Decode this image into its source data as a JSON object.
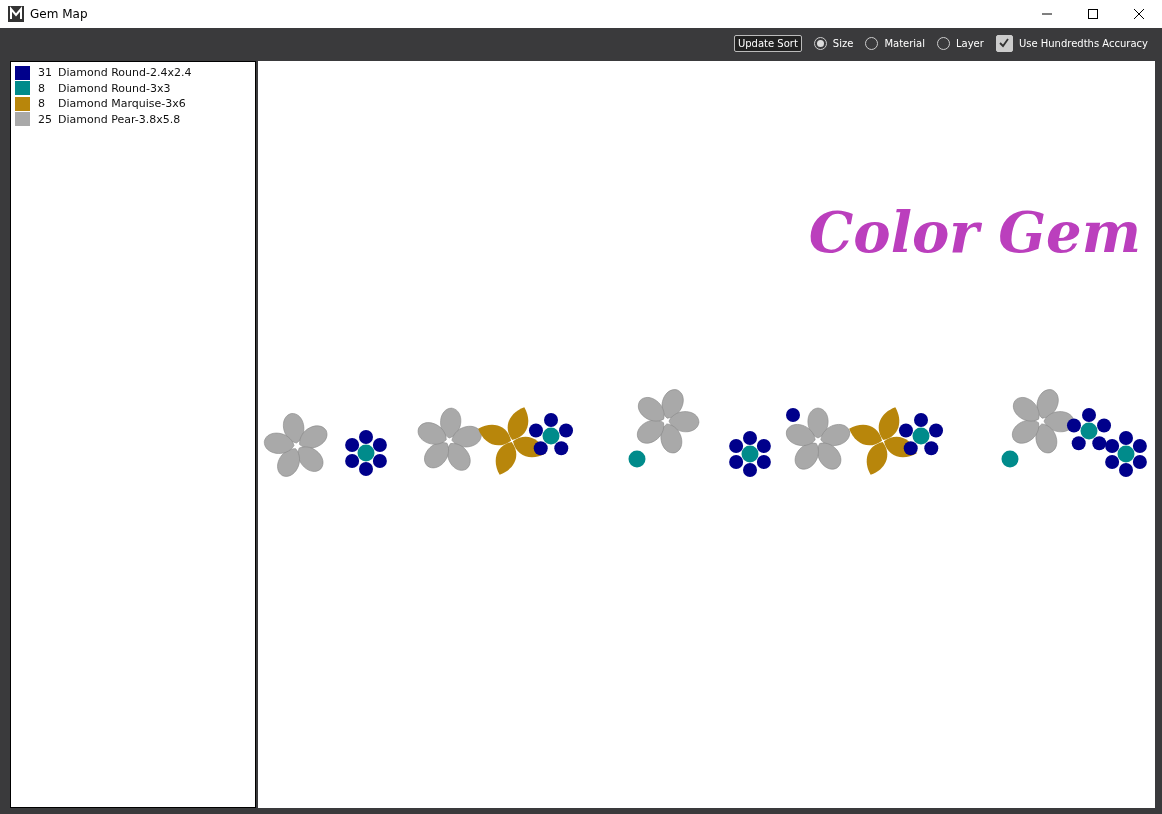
{
  "window": {
    "title": "Gem Map"
  },
  "toolbar": {
    "update_button": "Update Sort",
    "sort_options": [
      {
        "label": "Size",
        "selected": true
      },
      {
        "label": "Material",
        "selected": false
      },
      {
        "label": "Layer",
        "selected": false
      }
    ],
    "accuracy": {
      "label": "Use Hundredths Accuracy",
      "checked": true
    }
  },
  "legend": [
    {
      "count": "31",
      "name": "Diamond Round-2.4x2.4",
      "color": "#00008b"
    },
    {
      "count": "8",
      "name": "Diamond Round-3x3",
      "color": "#008b8b"
    },
    {
      "count": "8",
      "name": "Diamond Marquise-3x6",
      "color": "#b8860b"
    },
    {
      "count": "25",
      "name": "Diamond Pear-3.8x5.8",
      "color": "#a9a9a9"
    }
  ],
  "canvas": {
    "title": "Color Gem",
    "clusters": [
      {
        "kind": "pear-flower"
      },
      {
        "kind": "rosette"
      },
      {
        "kind": "pear-flower"
      },
      {
        "kind": "marquise-flower"
      },
      {
        "kind": "rosette"
      },
      {
        "kind": "pear-flower"
      },
      {
        "kind": "single-center"
      },
      {
        "kind": "rosette"
      },
      {
        "kind": "single-small"
      },
      {
        "kind": "pear-flower"
      },
      {
        "kind": "marquise-flower"
      },
      {
        "kind": "rosette"
      },
      {
        "kind": "pear-flower"
      },
      {
        "kind": "single-center"
      },
      {
        "kind": "rosette"
      },
      {
        "kind": "rosette"
      }
    ]
  }
}
